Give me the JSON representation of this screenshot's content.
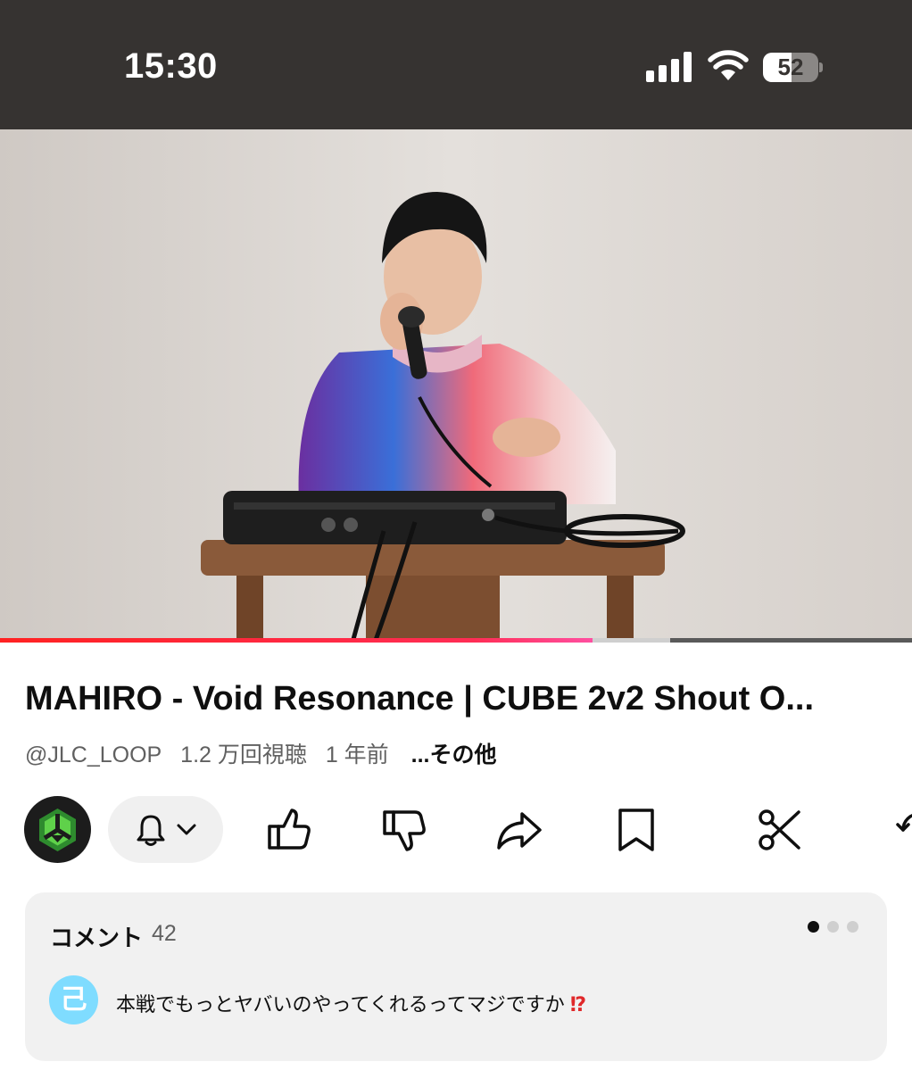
{
  "status_bar": {
    "time": "15:30",
    "battery_level": "52",
    "battery_fraction": 0.52
  },
  "video": {
    "progress_fraction": 0.65,
    "buffer_fraction": 0.735
  },
  "info": {
    "title": "MAHIRO - Void Resonance | CUBE 2v2 Shout O...",
    "channel": "@JLC_LOOP",
    "views": "1.2 万回視聴",
    "age": "1 年前",
    "more": "...その他"
  },
  "actions": {
    "icons": [
      "bell-icon",
      "chevron-down-icon",
      "thumbs-up-icon",
      "thumbs-down-icon",
      "share-icon",
      "bookmark-icon",
      "scissors-icon",
      "remix-icon"
    ]
  },
  "comments": {
    "label": "コメント",
    "count": "42",
    "avatar_letter": "己",
    "top_comment": "本戦でもっとヤバいのやってくれるってマジですか",
    "top_comment_emoji": "⁉",
    "accent_color": "#7fdcff"
  },
  "colors": {
    "status_bar_bg": "#363331",
    "progress": "#ff2d55"
  }
}
